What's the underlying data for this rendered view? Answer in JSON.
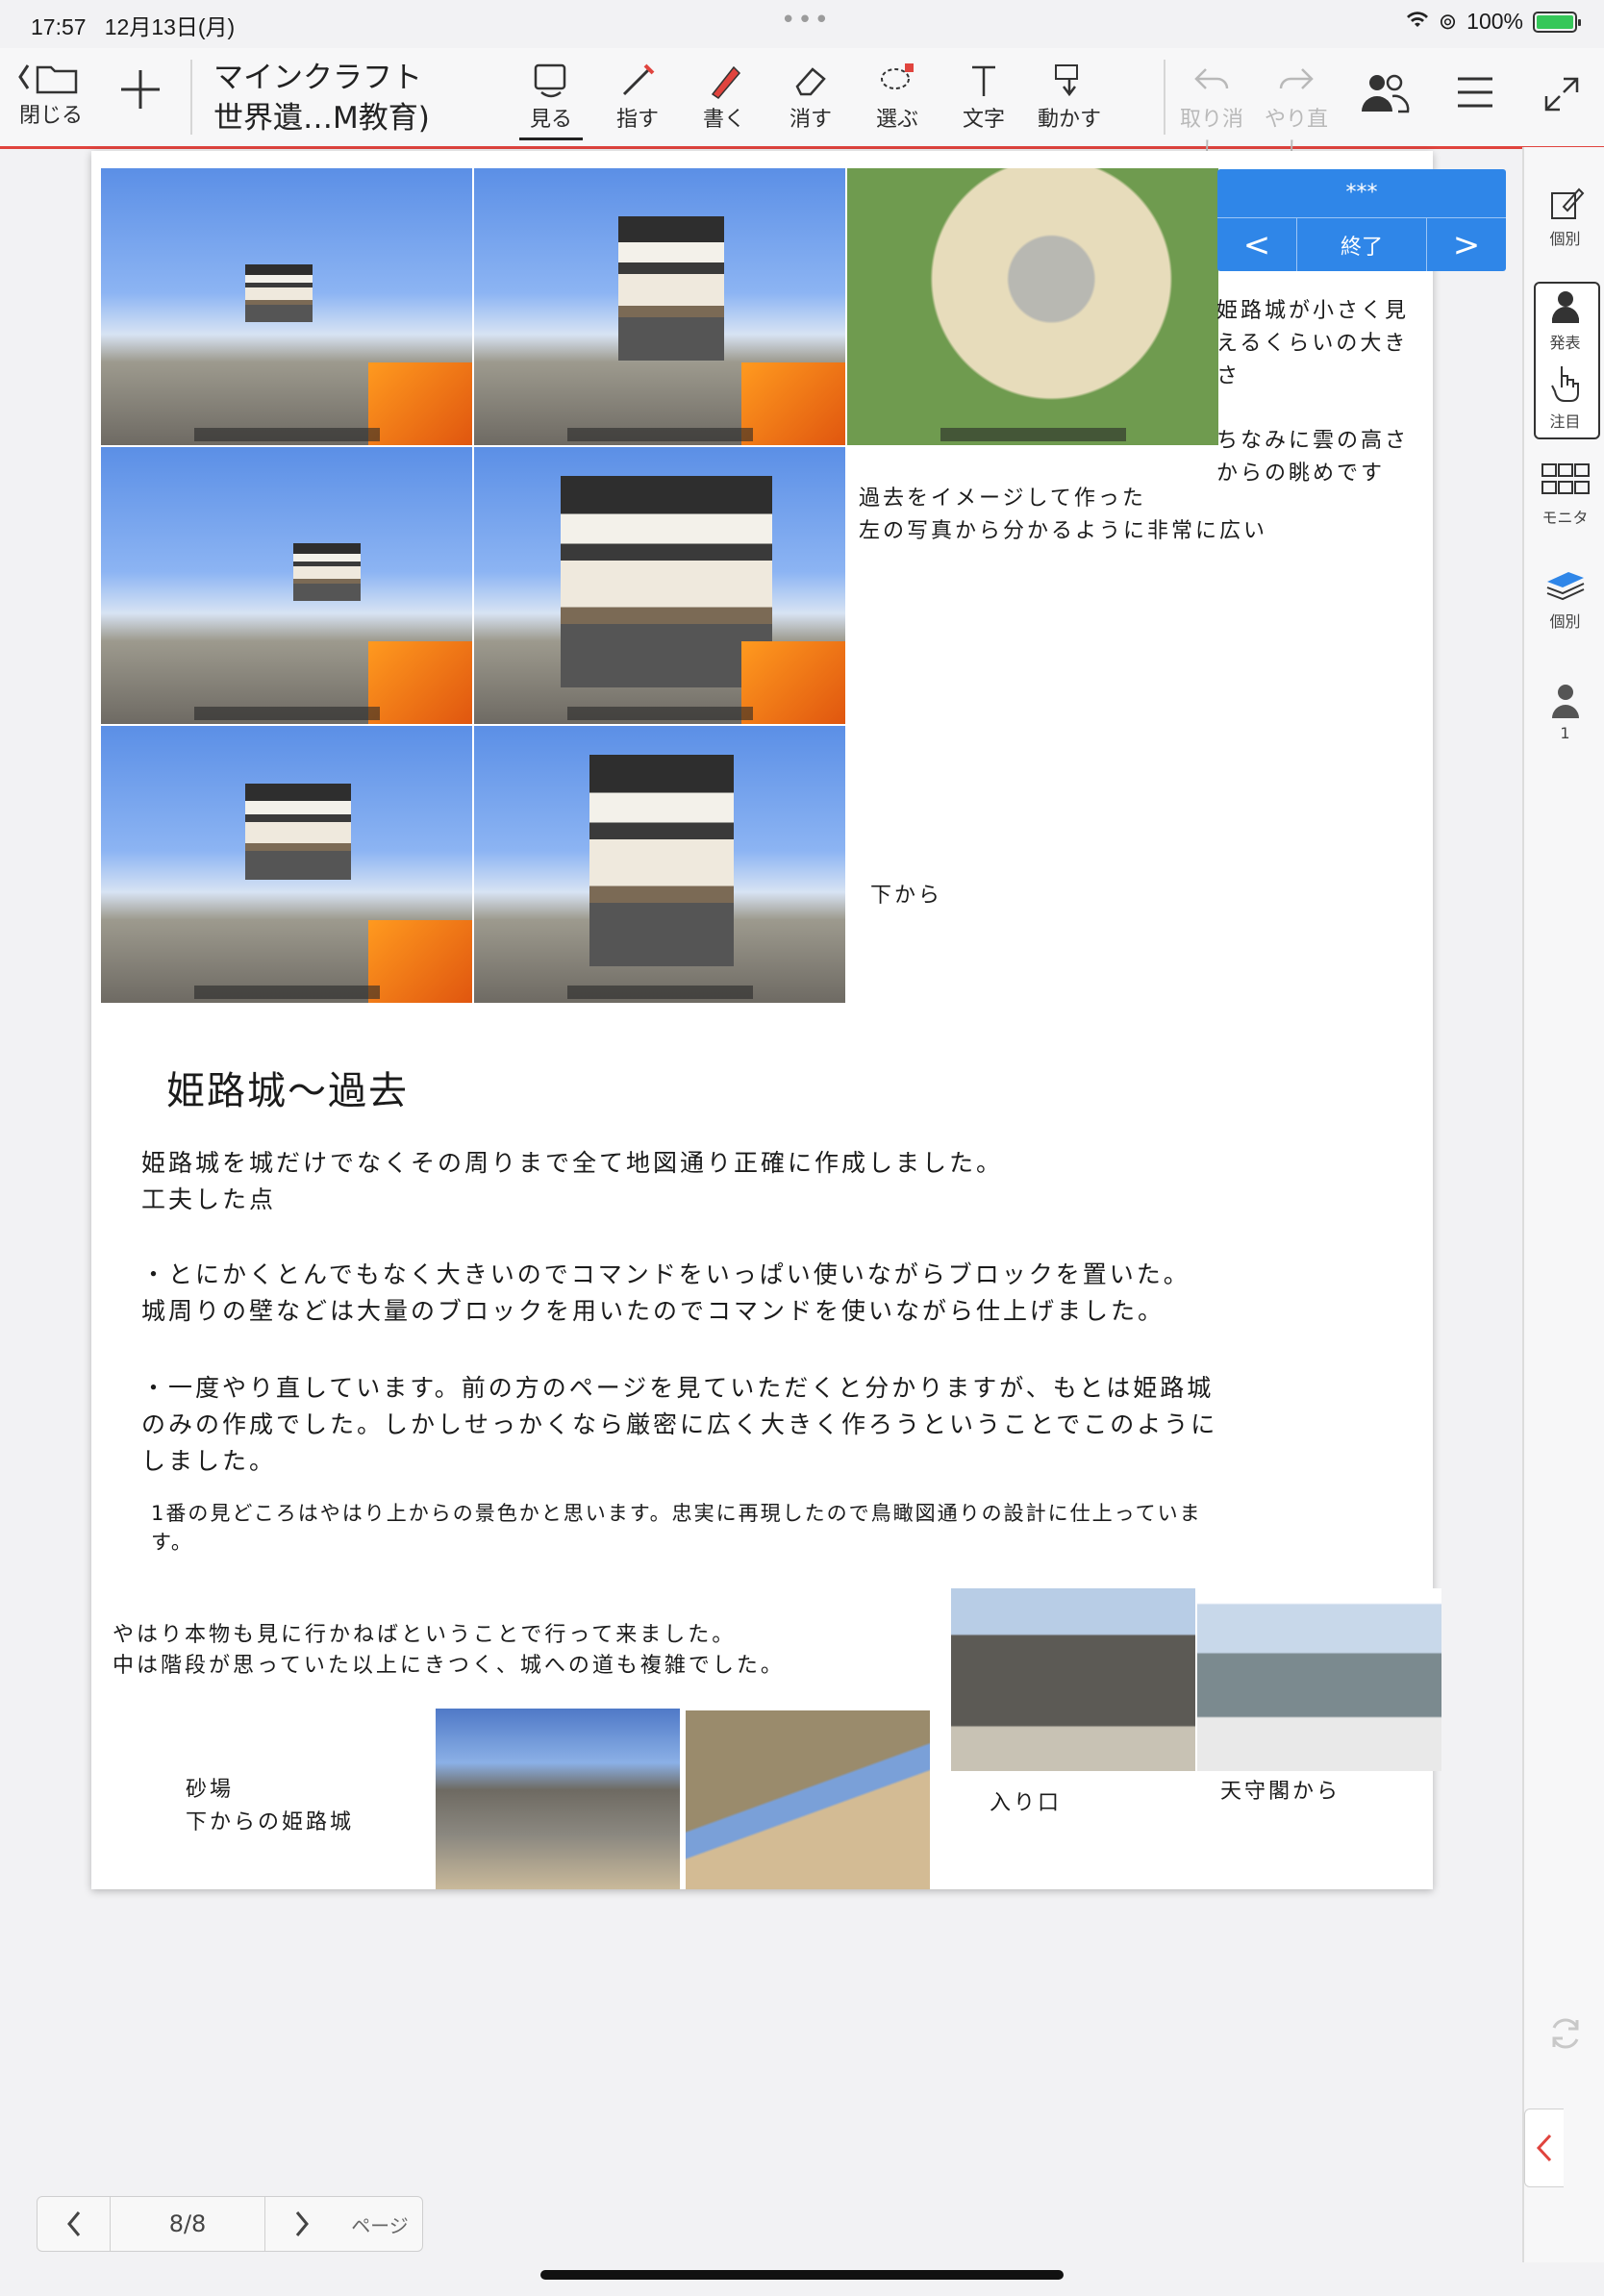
{
  "status": {
    "time": "17:57",
    "date": "12月13日(月)",
    "battery": "100%"
  },
  "toolbar": {
    "close_label": "閉じる",
    "doc_title_line1": "マインクラフト",
    "doc_title_line2": "世界遺…M教育)",
    "tools": [
      {
        "label": "見る",
        "icon": "eye-icon"
      },
      {
        "label": "指す",
        "icon": "pointer-icon"
      },
      {
        "label": "書く",
        "icon": "pen-icon"
      },
      {
        "label": "消す",
        "icon": "eraser-icon"
      },
      {
        "label": "選ぶ",
        "icon": "lasso-icon"
      },
      {
        "label": "文字",
        "icon": "text-icon"
      },
      {
        "label": "動かす",
        "icon": "move-icon"
      }
    ],
    "undo_label": "取り消し",
    "redo_label": "やり直し"
  },
  "sidebar": {
    "items": [
      "個別",
      "発表",
      "注目",
      "モニタ",
      "個別",
      "1"
    ]
  },
  "slide_nav": {
    "title": "***",
    "end_label": "終了",
    "prev": "<",
    "next": ">"
  },
  "content": {
    "note_top_right_1": "姫路城が小さく見\nえるくらいの大き\nさ",
    "note_top_right_2": "ちなみに雲の高さ\nからの眺めです",
    "note_middle": "過去をイメージして作った\n左の写真から分かるように非常に広い",
    "note_below": "下から",
    "heading": "姫路城～過去",
    "para1": "姫路城を城だけでなくその周りまで全て地図通り正確に作成しました。\n工夫した点",
    "para2": "・とにかくとんでもなく大きいのでコマンドをいっぱい使いながらブロックを置いた。\n城周りの壁などは大量のブロックを用いたのでコマンドを使いながら仕上げました。",
    "para3": "・一度やり直しています。前の方のページを見ていただくと分かりますが、もとは姫路城\nのみの作成でした。しかしせっかくなら厳密に広く大きく作ろうということでこのように\nしました。",
    "para4": "1番の見どころはやはり上からの景色かと思います。忠実に再現したので鳥瞰図通りの設計に仕上っていま\nす。",
    "visit_text": "やはり本物も見に行かねばということで行って来ました。\n中は階段が思っていた以上にきつく、城への道も複雑でした。",
    "caption_sand": "砂場\n下からの姫路城",
    "caption_entrance": "入り口",
    "caption_tower": "天守閣から"
  },
  "pager": {
    "current": "8/8",
    "page_label": "ページ"
  }
}
